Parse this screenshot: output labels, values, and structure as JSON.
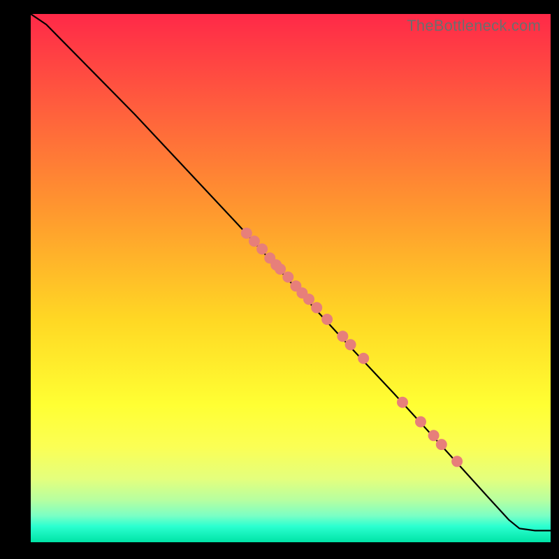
{
  "watermark": "TheBottleneck.com",
  "chart_data": {
    "type": "line",
    "title": "",
    "xlabel": "",
    "ylabel": "",
    "xlim": [
      0,
      100
    ],
    "ylim": [
      0,
      100
    ],
    "grid": false,
    "series": [
      {
        "name": "curve",
        "x": [
          0,
          3,
          6,
          10,
          14,
          20,
          30,
          40,
          50,
          60,
          70,
          80,
          88,
          92,
          94,
          97,
          100
        ],
        "y": [
          100,
          98,
          95,
          91,
          87,
          81,
          70.5,
          60,
          49.2,
          38.5,
          28,
          17.2,
          8.5,
          4.2,
          2.6,
          2.2,
          2.2
        ]
      }
    ],
    "scatter": {
      "name": "points",
      "x": [
        41.5,
        43.0,
        44.5,
        46.0,
        47.2,
        48.0,
        49.5,
        51.0,
        52.2,
        53.5,
        55.0,
        57.0,
        60.0,
        61.5,
        64.0,
        71.5,
        75.0,
        77.5,
        79.0,
        82.0
      ],
      "y": [
        58.5,
        57.0,
        55.5,
        53.8,
        52.5,
        51.7,
        50.2,
        48.5,
        47.2,
        46.0,
        44.4,
        42.2,
        39.0,
        37.4,
        34.8,
        26.5,
        22.8,
        20.2,
        18.5,
        15.3
      ]
    },
    "colors": {
      "curve": "#000000",
      "points": "#e77f7a"
    }
  }
}
